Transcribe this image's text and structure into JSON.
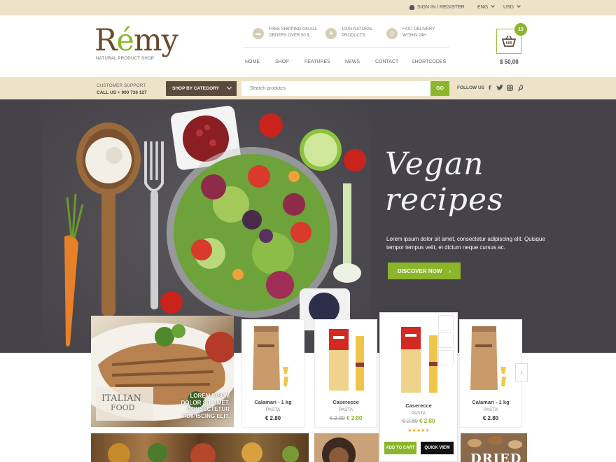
{
  "topbar": {
    "signin": "SIGN IN / REGISTER",
    "language": "ENG",
    "currency": "USD"
  },
  "header": {
    "logo_pre": "R",
    "logo_accent": "é",
    "logo_post": "my",
    "logo_sub": "NATURAL PRODUCT SHOP",
    "features": [
      {
        "line1": "FREE SHIPPING ON ALL",
        "line2": "ORDERS OVER 50 $",
        "icon": "truck-icon"
      },
      {
        "line1": "100% NATURAL",
        "line2": "PRODUCTS",
        "icon": "leaf-icon"
      },
      {
        "line1": "FAST DELIVERY",
        "line2": "WITHIN 24H",
        "icon": "clock-icon"
      }
    ],
    "nav": [
      "HOME",
      "SHOP",
      "FEATURES",
      "NEWS",
      "CONTACT",
      "SHORTCODES"
    ],
    "cart_count": "15",
    "cart_total": "$ 50,00"
  },
  "bar2": {
    "support_label": "CUSTOMER SUPPORT",
    "support_phone": "CALL US + 900 736 127",
    "category_button": "SHOP BY CATEGORY",
    "search_placeholder": "Search produtcs",
    "go": "GO",
    "follow": "FOLLOW US",
    "social": [
      "f",
      "t",
      "i",
      "p"
    ]
  },
  "hero": {
    "title_line1": "Vegan",
    "title_line2": "recipes",
    "text": "Lorem ipsum dolor sit amet, consectetur adipiscing elit. Quisque tempor tempus velit, et dictum neque cursus ac.",
    "cta": "DISCOVER NOW"
  },
  "promo": {
    "label_line1": "ITALIAN",
    "label_line2": "FOOD",
    "text": "LOREM IPSUM DOLOR SIT AMET, CONSECTETUR ADIPISCING ELIT."
  },
  "products": [
    {
      "name": "Calamari - 1 kg",
      "category": "PASTA",
      "price": "€ 2.80",
      "old_price": ""
    },
    {
      "name": "Caserecce",
      "category": "PASTA",
      "price": "€ 2.80",
      "old_price": "€ 2.80"
    },
    {
      "name": "Caserecce",
      "category": "PASTA",
      "price": "€ 2.80",
      "old_price": "€ 2.80",
      "rating": 4
    },
    {
      "name": "Calamari - 1 kg",
      "category": "PASTA",
      "price": "€ 2.80",
      "old_price": ""
    }
  ],
  "product_actions": {
    "add_to_cart": "ADD TO CART",
    "quick_view": "QUICK VIEW"
  },
  "bottom": {
    "dried": "DRIED"
  },
  "colors": {
    "accent": "#8bb52a",
    "beige": "#ede3c8",
    "brown": "#5a4b3c",
    "hero_bg": "#454349"
  }
}
